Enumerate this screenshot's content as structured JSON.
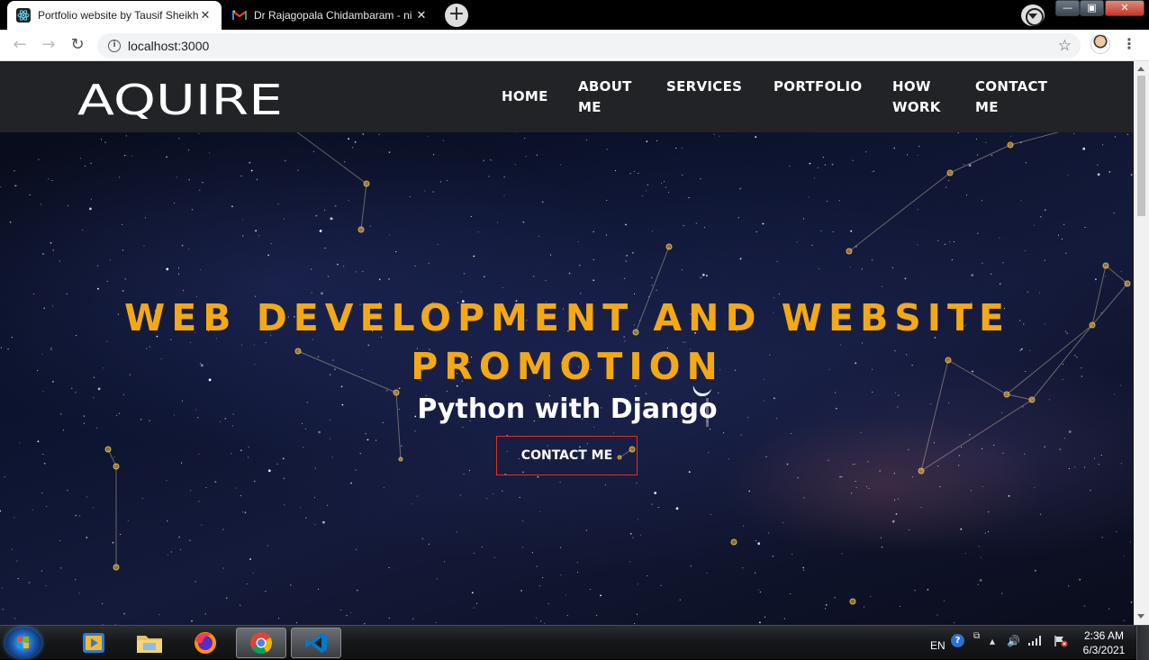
{
  "browser": {
    "tabs": [
      {
        "title": "Portfolio website by Tausif Sheikh",
        "active": true,
        "icon": "react-icon"
      },
      {
        "title": "Dr Rajagopala Chidambaram - ni",
        "active": false,
        "icon": "gmail-icon"
      }
    ],
    "new_tab_label": "+",
    "url": "localhost:3000"
  },
  "site": {
    "logo": "AQUIRE",
    "nav": [
      {
        "line1": "HOME",
        "line2": ""
      },
      {
        "line1": "ABOUT",
        "line2": "ME"
      },
      {
        "line1": "SERVICES",
        "line2": ""
      },
      {
        "line1": "PORTFOLIO",
        "line2": ""
      },
      {
        "line1": "HOW",
        "line2": "WORK"
      },
      {
        "line1": "CONTACT",
        "line2": "ME"
      }
    ],
    "hero": {
      "title_line1": "WEB DEVELOPMENT AND WEBSITE",
      "title_line2": "PROMOTION",
      "subtitle": "Python with Django",
      "button": "CONTACT ME"
    },
    "colors": {
      "accent": "#f4a914",
      "button_border": "#e0301e",
      "header_bg": "#222326"
    }
  },
  "taskbar": {
    "language": "EN",
    "time": "2:36 AM",
    "date": "6/3/2021",
    "apps": [
      "media-player-icon",
      "file-explorer-icon",
      "firefox-icon",
      "chrome-icon",
      "vscode-icon"
    ]
  }
}
